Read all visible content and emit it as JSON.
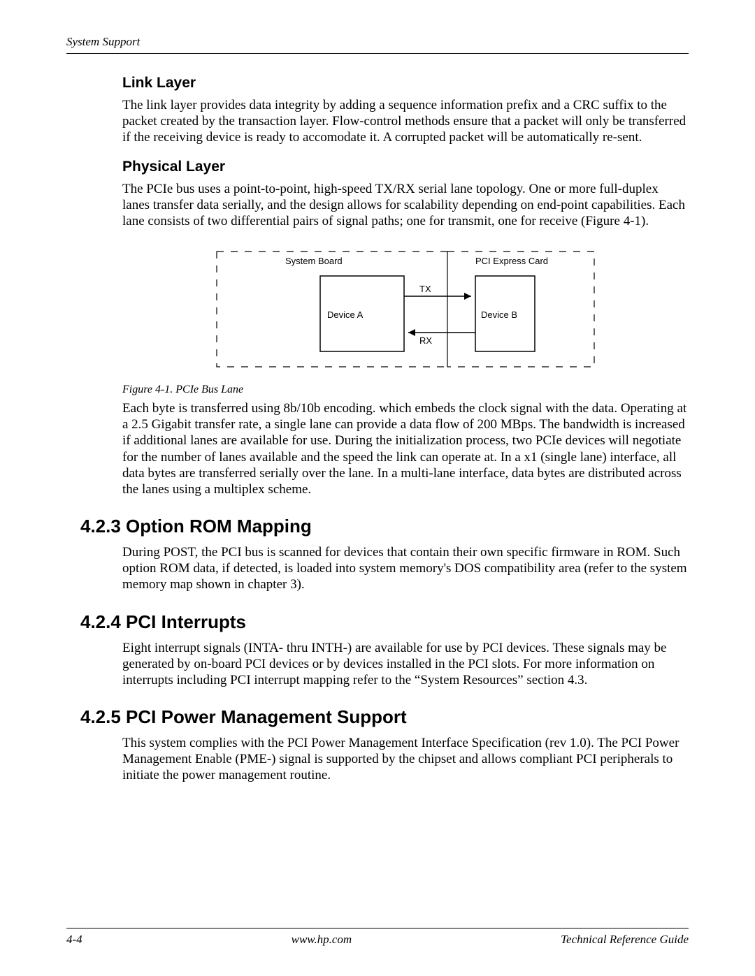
{
  "header": {
    "section_label": "System Support"
  },
  "sections": {
    "link_layer": {
      "title": "Link Layer",
      "body": "The link layer provides data integrity by adding a sequence information prefix and a CRC suffix to the packet created by the transaction layer. Flow-control methods ensure that a packet will only be transferred if the receiving device is ready to accomodate it. A corrupted packet will be automatically re-sent."
    },
    "physical_layer": {
      "title": "Physical Layer",
      "intro": "The PCIe bus uses a point-to-point, high-speed TX/RX serial lane topology. One or more full-duplex lanes transfer data serially, and the design allows for scalability depending on end-point capabilities. Each lane consists of two differential pairs of signal paths; one for transmit, one for receive (Figure 4-1).",
      "diagram": {
        "left_box_title": "System Board",
        "right_box_title": "PCI Express Card",
        "device_a": "Device A",
        "device_b": "Device B",
        "tx": "TX",
        "rx": "RX"
      },
      "fig_caption": "Figure 4-1. PCIe Bus Lane",
      "detail": "Each byte is transferred using 8b/10b encoding. which embeds the clock signal with the data. Operating at a 2.5 Gigabit transfer rate, a single lane can provide a data flow of 200 MBps. The bandwidth is increased if additional lanes are available for use. During the initialization process, two PCIe devices will negotiate for the number of lanes available and the speed the link can operate at. In a x1 (single lane) interface, all data bytes are transferred serially over the lane. In a multi-lane interface, data bytes are distributed across the lanes using a multiplex scheme."
    },
    "option_rom": {
      "title": "4.2.3 Option ROM Mapping",
      "body": "During POST,  the PCI bus is scanned for devices that contain their own specific firmware in ROM. Such option ROM data, if detected, is loaded into system memory's DOS compatibility area (refer to the system memory map shown in chapter 3)."
    },
    "pci_interrupts": {
      "title": "4.2.4 PCI Interrupts",
      "body": "Eight interrupt signals (INTA- thru INTH-) are available for use by PCI devices. These signals may be generated by on-board PCI devices or by devices installed in the PCI slots. For more information on interrupts including PCI interrupt mapping refer to the “System Resources” section 4.3."
    },
    "pci_power": {
      "title": "4.2.5 PCI Power Management Support",
      "body": "This system complies with the PCI Power Management Interface Specification (rev 1.0). The PCI Power Management Enable (PME-) signal is supported by the chipset and allows compliant PCI peripherals to initiate the power management routine."
    }
  },
  "footer": {
    "page_num": "4-4",
    "url": "www.hp.com",
    "doc_title": "Technical Reference Guide"
  }
}
